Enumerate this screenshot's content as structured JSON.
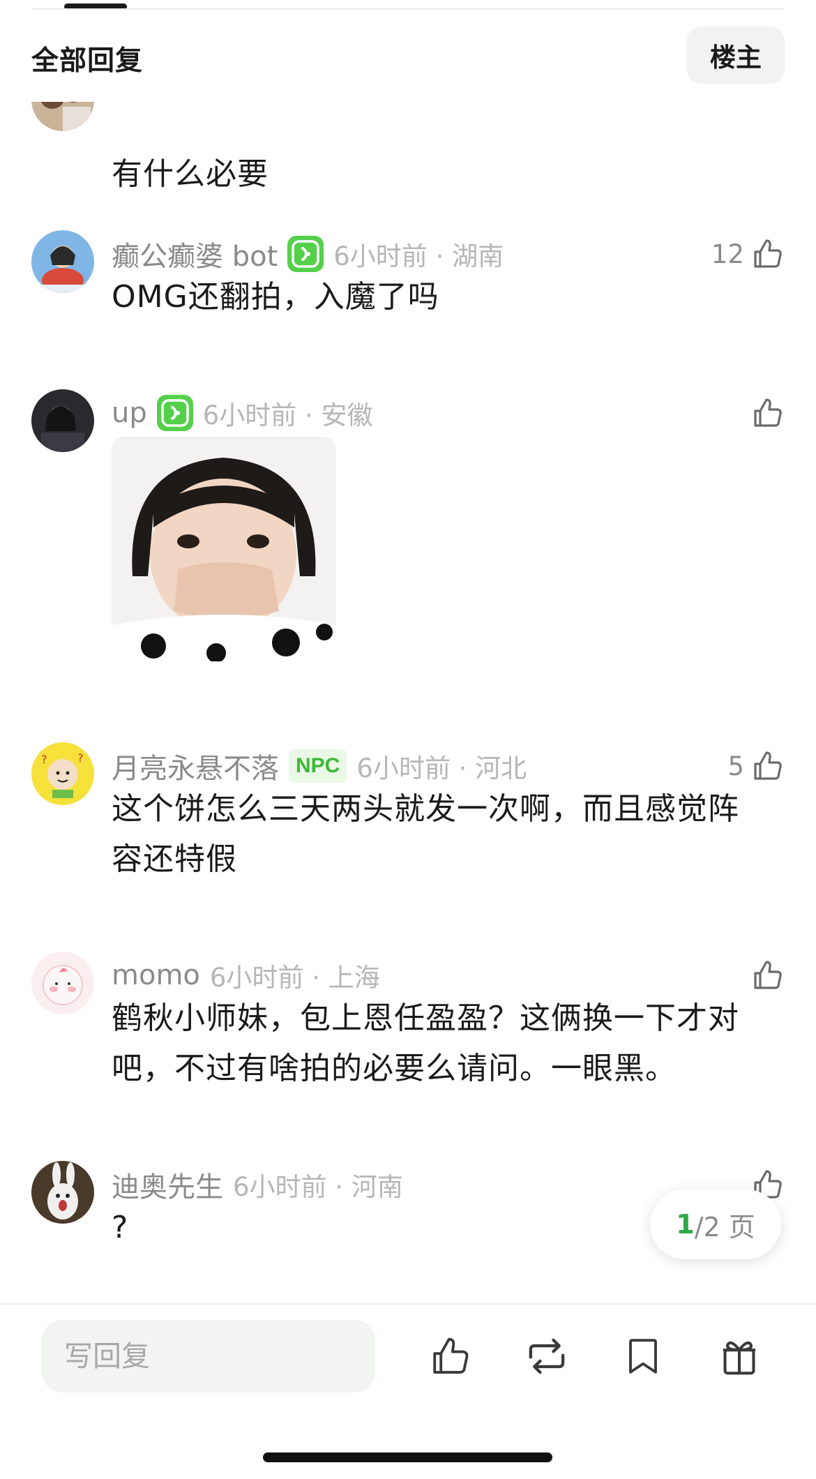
{
  "header": {
    "title": "全部回复",
    "op_button": "楼主"
  },
  "comments": [
    {
      "text": "有什么必要"
    },
    {
      "username": "癫公癫婆 bot",
      "time": "6小时前",
      "location": "湖南",
      "likes": "12",
      "text": "OMG还翻拍，入魔了吗"
    },
    {
      "username": "up",
      "time": "6小时前",
      "location": "安徽",
      "likes": ""
    },
    {
      "username": "月亮永悬不落",
      "badge": "NPC",
      "time": "6小时前",
      "location": "河北",
      "likes": "5",
      "text": "这个饼怎么三天两头就发一次啊，而且感觉阵容还特假"
    },
    {
      "username": "momo",
      "time": "6小时前",
      "location": "上海",
      "likes": "",
      "text": "鹤秋小师妹，包上恩任盈盈？这俩换一下才对吧，不过有啥拍的必要么请问。一眼黑。"
    },
    {
      "username": "迪奥先生",
      "time": "6小时前",
      "location": "河南",
      "likes": "",
      "text": "?"
    }
  ],
  "pagination": {
    "current": "1",
    "total_label": "/2 页"
  },
  "bottom_bar": {
    "reply_placeholder": "写回复"
  },
  "colors": {
    "accent_green": "#54d04a",
    "badge_text": "#3db83a",
    "muted": "#8a8a8a",
    "light_muted": "#b6b6b6"
  },
  "icons": [
    "thumbs-up-icon",
    "badge-smile-icon",
    "repost-icon",
    "bookmark-icon",
    "gift-icon"
  ]
}
